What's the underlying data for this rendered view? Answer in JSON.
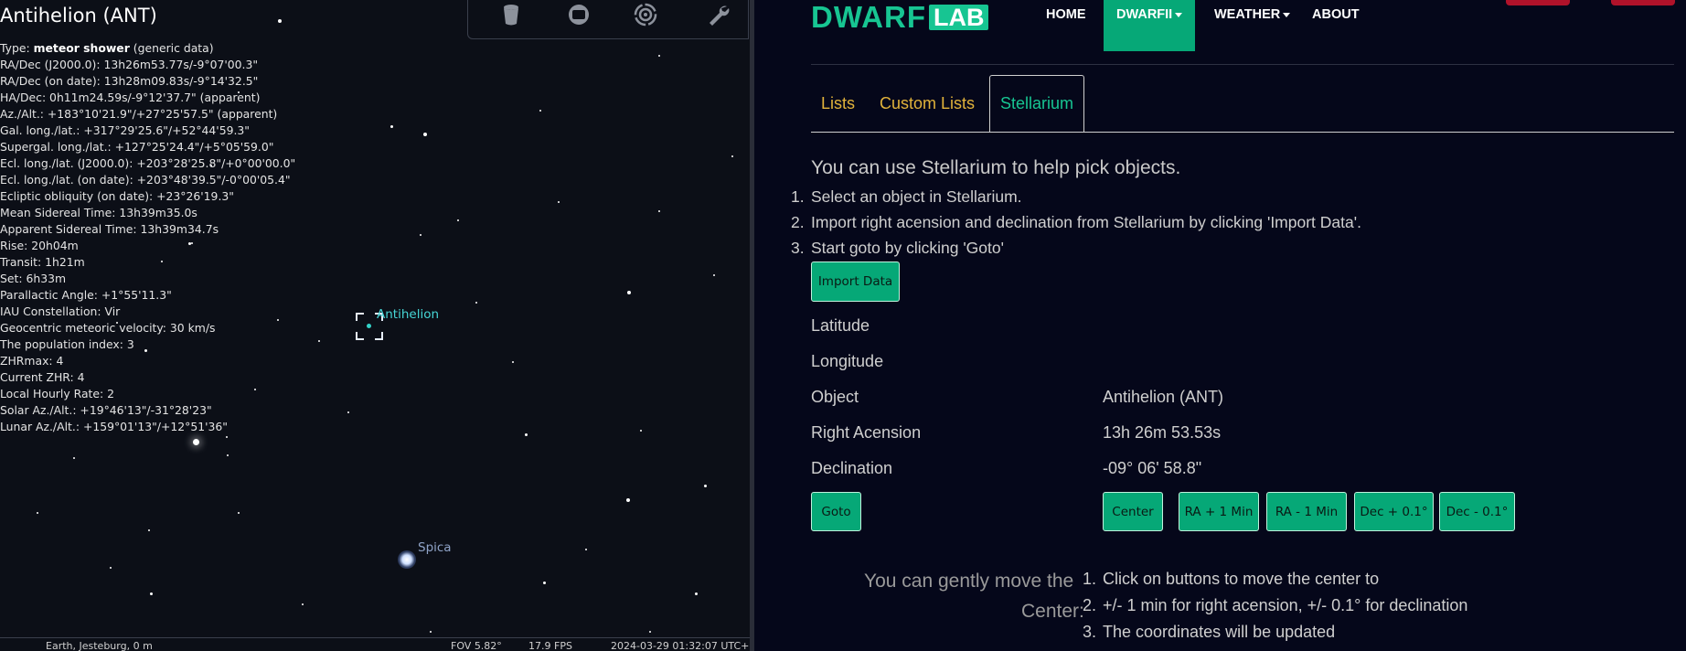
{
  "stellarium": {
    "object_title": "Antihelion (ANT)",
    "info_type_prefix": "Type: ",
    "info_type_bold": "meteor shower",
    "info_type_suffix": " (generic data)",
    "info_lines": [
      "RA/Dec (J2000.0): 13h26m53.77s/-9°07'00.3\"",
      "RA/Dec (on date): 13h28m09.83s/-9°14'32.5\"",
      "HA/Dec: 0h11m24.59s/-9°12'37.7\" (apparent)",
      "Az./Alt.: +183°10'21.9\"/+27°25'57.5\" (apparent)",
      "Gal. long./lat.: +317°29'25.6\"/+52°44'59.3\"",
      "Supergal. long./lat.: +127°25'24.4\"/+5°05'59.0\"",
      "Ecl. long./lat. (J2000.0): +203°28'25.8\"/+0°00'00.0\"",
      "Ecl. long./lat. (on date): +203°48'39.5\"/-0°00'05.4\"",
      "Ecliptic obliquity (on date): +23°26'19.3\"",
      "Mean Sidereal Time: 13h39m35.0s",
      "Apparent Sidereal Time: 13h39m34.7s",
      "Rise: 20h04m",
      "Transit: 1h21m",
      "Set: 6h33m",
      "Parallactic Angle: +1°55'11.3\"",
      "IAU Constellation: Vir",
      "Geocentric meteoric velocity: 30 km/s",
      "The population index: 3",
      "ZHRmax: 4",
      "Current ZHR: 4",
      "Local Hourly Rate: 2",
      "Solar Az./Alt.: +19°46'13\"/-31°28'23\"",
      "Lunar Az./Alt.: +159°01'13\"/+12°51'36\""
    ],
    "labels": {
      "antihelion": "Antihelion",
      "spica": "Spica"
    },
    "toolbar_icons": [
      "trash-icon",
      "screen-icon",
      "target-icon",
      "wrench-icon"
    ],
    "status": {
      "location": "Earth, Jesteburg, 0 m",
      "fov": "FOV 5.82°",
      "fps": "17.9 FPS",
      "datetime": "2024-03-29 01:32:07 UTC+1"
    }
  },
  "app": {
    "logo": {
      "part1": "DWARF",
      "part2": "LAB"
    },
    "nav": {
      "home": "HOME",
      "dwarf": "DWARFII",
      "weather": "WEATHER",
      "about": "ABOUT"
    },
    "tabs": {
      "lists": "Lists",
      "custom_lists": "Custom Lists",
      "stellarium": "Stellarium"
    },
    "lead": "You can use Stellarium to help pick objects.",
    "steps": [
      "Select an object in Stellarium.",
      "Import right acension and declination from Stellarium by clicking 'Import Data'.",
      "Start goto by clicking 'Goto'"
    ],
    "import_button": "Import Data",
    "fields": {
      "latitude_label": "Latitude",
      "longitude_label": "Longitude",
      "object_label": "Object",
      "object_value": "Antihelion (ANT)",
      "ra_label": "Right Acension",
      "ra_value": "13h 26m 53.53s",
      "dec_label": "Declination",
      "dec_value": "-09° 06' 58.8\""
    },
    "buttons": {
      "goto": "Goto",
      "center": "Center",
      "ra_plus": "RA + 1 Min",
      "ra_minus": "RA - 1 Min",
      "dec_plus": "Dec + 0.1°",
      "dec_minus": "Dec - 0.1°"
    },
    "move_text": {
      "line1": "You can gently move the",
      "line2": "Center:"
    },
    "move_steps": [
      "Click on buttons to move the center to",
      "+/- 1 min for right acension, +/- 0.1° for declination",
      "The coordinates will be updated"
    ],
    "colors": {
      "accent": "#06a877",
      "tab_link": "#e2b33b",
      "logo": "#17c592",
      "background": "#05071a"
    }
  }
}
